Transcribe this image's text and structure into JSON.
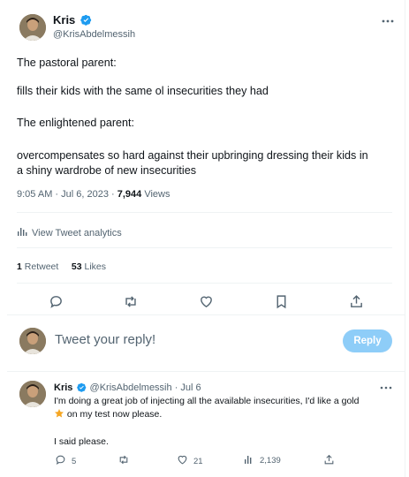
{
  "tweet": {
    "author_name": "Kris",
    "author_handle": "@KrisAbdelmessih",
    "lines": [
      "The pastoral parent:",
      "fills their kids with the same ol insecurities they had",
      "The enlightened parent:",
      "overcompensates so hard against their upbringing dressing their kids in",
      "a shiny wardrobe of new insecurities"
    ],
    "time": "9:05 AM · Jul 6, 2023 ·",
    "views_count": "7,944",
    "views_label": "Views",
    "analytics_label": "View Tweet analytics",
    "retweets_count": "1",
    "retweets_label": "Retweet",
    "likes_count": "53",
    "likes_label": "Likes"
  },
  "composer": {
    "placeholder": "Tweet your reply!",
    "button_label": "Reply"
  },
  "reply": {
    "author_name": "Kris",
    "author_handle": "@KrisAbdelmessih",
    "date": "· Jul 6",
    "line1": "I'm doing a great job of injecting all the available insecurities, I'd like a gold",
    "line2": "on my test now please.",
    "line3": "I said please.",
    "reply_count": "5",
    "like_count": "21",
    "view_count": "2,139"
  },
  "icons": {
    "verified_color": "#1d9bf0",
    "star_color": "#f5a623"
  }
}
